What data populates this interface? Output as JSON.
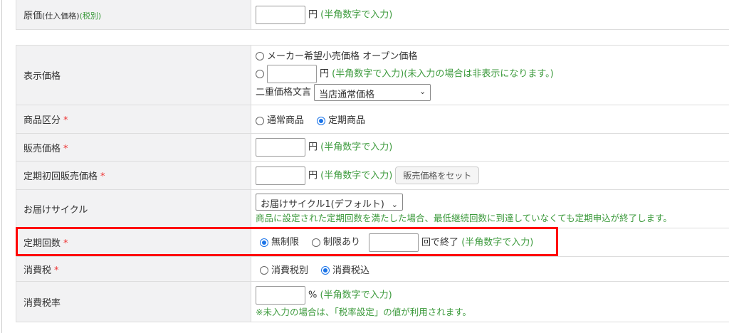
{
  "cost": {
    "label": "原価",
    "sub1": "(仕入価格)",
    "sub2": "(税別)",
    "unit": "円",
    "hint": "(半角数字で入力)"
  },
  "display_price": {
    "label": "表示価格",
    "opt1": "メーカー希望小売価格 オープン価格",
    "unit": "円",
    "hint": "(半角数字で入力)(未入力の場合は非表示になります。)",
    "dual_label": "二重価格文言",
    "dual_value": "当店通常価格"
  },
  "category": {
    "label": "商品区分",
    "req": "*",
    "opt1": "通常商品",
    "opt2": "定期商品",
    "selected": "定期商品"
  },
  "sale_price": {
    "label": "販売価格",
    "req": "*",
    "unit": "円",
    "hint": "(半角数字で入力)"
  },
  "first_price": {
    "label": "定期初回販売価格",
    "req": "*",
    "unit": "円",
    "hint": "(半角数字で入力)",
    "button": "販売価格をセット"
  },
  "cycle": {
    "label": "お届けサイクル",
    "value": "お届けサイクル1(デフォルト)",
    "note": "商品に設定された定期回数を満たした場合、最低継続回数に到達していなくても定期申込が終了します。"
  },
  "count": {
    "label": "定期回数",
    "req": "*",
    "opt1": "無制限",
    "opt2": "制限あり",
    "selected": "無制限",
    "suffix": "回で終了",
    "hint": "(半角数字で入力)"
  },
  "tax": {
    "label": "消費税",
    "req": "*",
    "opt1": "消費税別",
    "opt2": "消費税込",
    "selected": "消費税込"
  },
  "tax_rate": {
    "label": "消費税率",
    "unit": "%",
    "hint": "(半角数字で入力)",
    "note": "※未入力の場合は、「税率設定」の値が利用されます。"
  },
  "colors": {
    "highlight": "#ff0000",
    "hint": "#3c9a3c",
    "radio": "#1a73e8"
  }
}
